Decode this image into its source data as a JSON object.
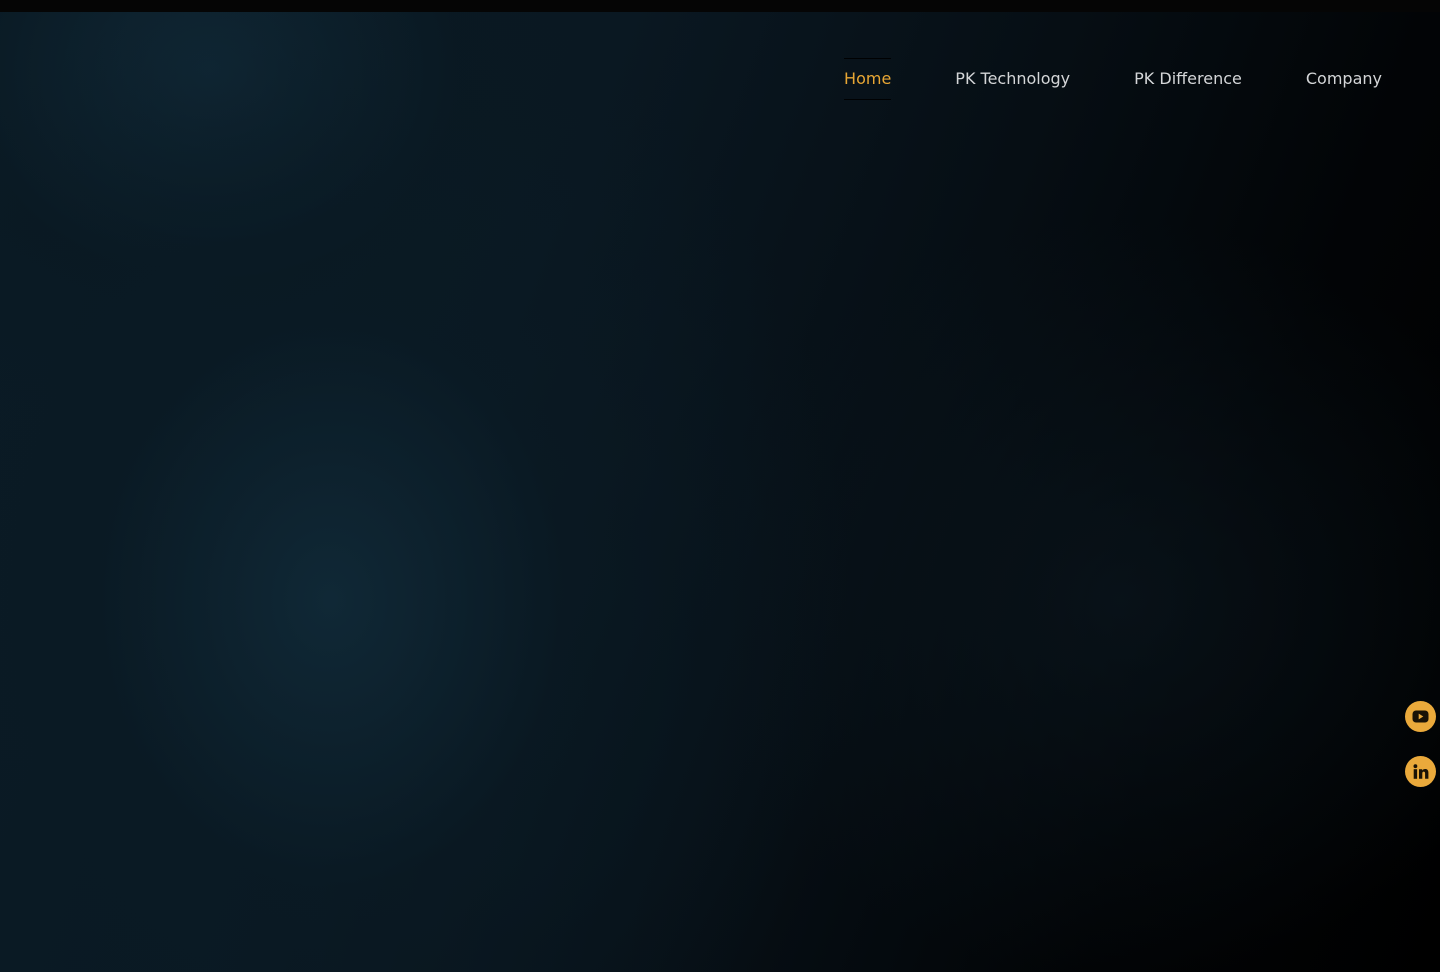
{
  "nav": {
    "items": [
      {
        "label": "Home",
        "active": true
      },
      {
        "label": "PK Technology",
        "active": false
      },
      {
        "label": "PK Difference",
        "active": false
      },
      {
        "label": "Company",
        "active": false
      }
    ]
  },
  "social": {
    "icons": [
      "youtube-icon",
      "linkedin-icon"
    ]
  },
  "colors": {
    "accent": "#e8a634",
    "nav_text": "#d4d6d8",
    "background_dark": "#000000",
    "background_teal": "#0f2533"
  }
}
